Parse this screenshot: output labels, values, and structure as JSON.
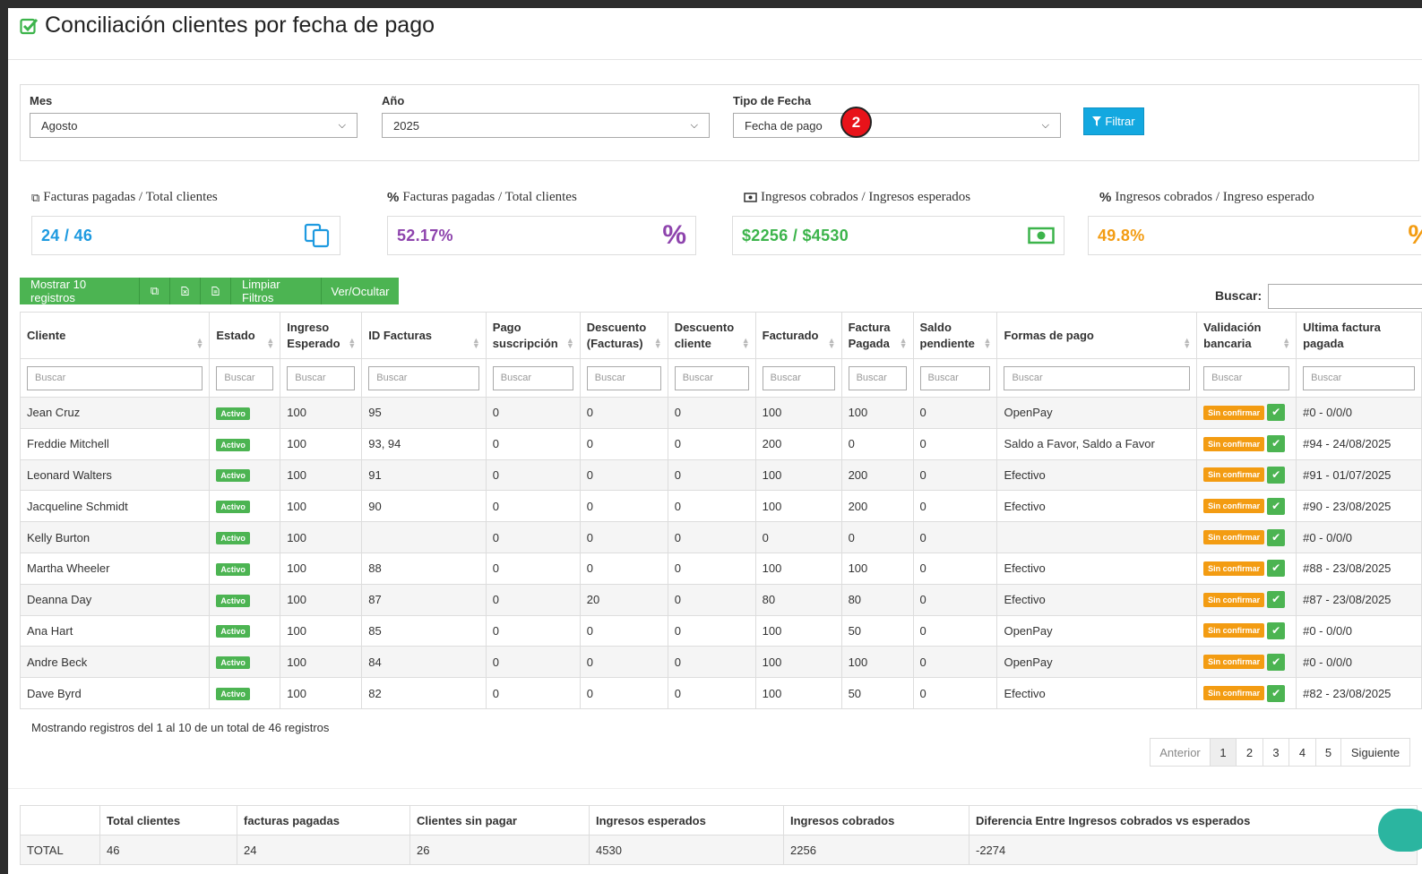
{
  "title": "Conciliación clientes por fecha de pago",
  "filters": {
    "mes_label": "Mes",
    "mes_value": "Agosto",
    "anio_label": "Año",
    "anio_value": "2025",
    "tipo_label": "Tipo de Fecha",
    "tipo_value": "Fecha de pago",
    "filtrar_label": "Filtrar",
    "badge": "2"
  },
  "stats": [
    {
      "label": "Facturas pagadas / Total clientes",
      "value": "24 / 46",
      "color": "#1e9ae0",
      "icon": "copy-icon"
    },
    {
      "label": "Facturas pagadas / Total clientes",
      "value": "52.17%",
      "color": "#8e44ad",
      "icon": "percent-icon"
    },
    {
      "label": "Ingresos cobrados / Ingresos esperados",
      "value": "$2256 / $4530",
      "color": "#3cb44b",
      "icon": "money-icon"
    },
    {
      "label": "Ingresos cobrados / Ingreso esperado",
      "value": "49.8%",
      "color": "#f39c12",
      "icon": "percent-icon"
    }
  ],
  "toolbar": {
    "show_label": "Mostrar 10 registros",
    "clean_label": "Limpiar Filtros",
    "toggle_label": "Ver/Ocultar",
    "search_label": "Buscar:"
  },
  "table": {
    "headers": [
      "Cliente",
      "Estado",
      "Ingreso Esperado",
      "ID Facturas",
      "Pago suscripción",
      "Descuento (Facturas)",
      "Descuento cliente",
      "Facturado",
      "Factura Pagada",
      "Saldo pendiente",
      "Formas de pago",
      "Validación bancaria",
      "Ultima factura pagada"
    ],
    "filter_placeholder": "Buscar",
    "status_label": "Activo",
    "validation_label": "Sin confirmar",
    "rows": [
      [
        "Jean Cruz",
        "100",
        "95",
        "0",
        "0",
        "0",
        "100",
        "100",
        "0",
        "OpenPay",
        "#0 - 0/0/0"
      ],
      [
        "Freddie Mitchell",
        "100",
        "93, 94",
        "0",
        "0",
        "0",
        "200",
        "0",
        "0",
        "Saldo a Favor, Saldo a Favor",
        "#94 - 24/08/2025"
      ],
      [
        "Leonard Walters",
        "100",
        "91",
        "0",
        "0",
        "0",
        "100",
        "200",
        "0",
        "Efectivo",
        "#91 - 01/07/2025"
      ],
      [
        "Jacqueline Schmidt",
        "100",
        "90",
        "0",
        "0",
        "0",
        "100",
        "200",
        "0",
        "Efectivo",
        "#90 - 23/08/2025"
      ],
      [
        "Kelly Burton",
        "100",
        "",
        "0",
        "0",
        "0",
        "0",
        "0",
        "0",
        "",
        "#0 - 0/0/0"
      ],
      [
        "Martha Wheeler",
        "100",
        "88",
        "0",
        "0",
        "0",
        "100",
        "100",
        "0",
        "Efectivo",
        "#88 - 23/08/2025"
      ],
      [
        "Deanna Day",
        "100",
        "87",
        "0",
        "20",
        "0",
        "80",
        "80",
        "0",
        "Efectivo",
        "#87 - 23/08/2025"
      ],
      [
        "Ana Hart",
        "100",
        "85",
        "0",
        "0",
        "0",
        "100",
        "50",
        "0",
        "OpenPay",
        "#0 - 0/0/0"
      ],
      [
        "Andre Beck",
        "100",
        "84",
        "0",
        "0",
        "0",
        "100",
        "100",
        "0",
        "OpenPay",
        "#0 - 0/0/0"
      ],
      [
        "Dave Byrd",
        "100",
        "82",
        "0",
        "0",
        "0",
        "100",
        "50",
        "0",
        "Efectivo",
        "#82 - 23/08/2025"
      ]
    ]
  },
  "info": "Mostrando registros del 1 al 10 de un total de 46 registros",
  "pagination": {
    "prev": "Anterior",
    "pages": [
      "1",
      "2",
      "3",
      "4",
      "5"
    ],
    "next": "Siguiente",
    "active": "1"
  },
  "totals": {
    "headers": [
      "",
      "Total clientes",
      "facturas pagadas",
      "Clientes sin pagar",
      "Ingresos esperados",
      "Ingresos cobrados",
      "Diferencia Entre Ingresos cobrados vs esperados"
    ],
    "row": [
      "TOTAL",
      "46",
      "24",
      "26",
      "4530",
      "2256",
      "-2274"
    ]
  }
}
